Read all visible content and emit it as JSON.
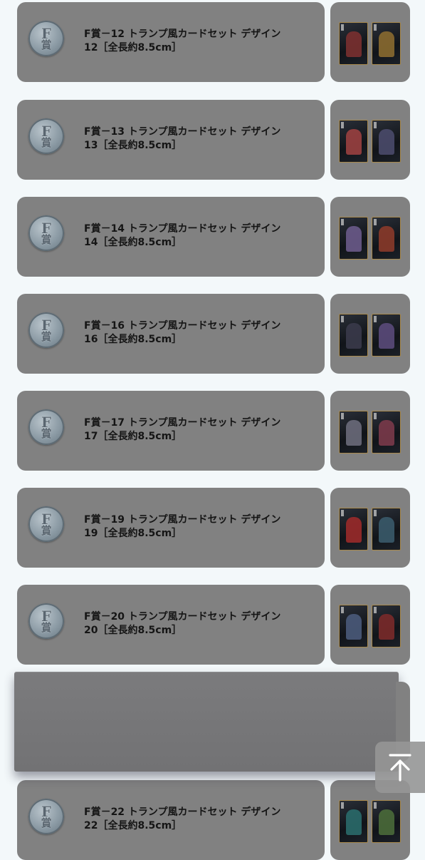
{
  "items": [
    {
      "code": "F賞－12",
      "title": "トランプ風カードセット デザイン",
      "detail": "12［全長約8.5cm］",
      "badge_letter": "F",
      "badge_kanji": "賞",
      "art_left": "#7a3030",
      "art_right": "#8a6a30"
    },
    {
      "code": "F賞－13",
      "title": "トランプ風カードセット デザイン",
      "detail": "13［全長約8.5cm］",
      "badge_letter": "F",
      "badge_kanji": "賞",
      "art_left": "#9a4040",
      "art_right": "#4a4a6a"
    },
    {
      "code": "F賞－14",
      "title": "トランプ風カードセット デザイン",
      "detail": "14［全長約8.5cm］",
      "badge_letter": "F",
      "badge_kanji": "賞",
      "art_left": "#6a5a8a",
      "art_right": "#8a3a2a"
    },
    {
      "code": "F賞－16",
      "title": "トランプ風カードセット デザイン",
      "detail": "16［全長約8.5cm］",
      "badge_letter": "F",
      "badge_kanji": "賞",
      "art_left": "#3a3a4a",
      "art_right": "#5a4a7a"
    },
    {
      "code": "F賞－17",
      "title": "トランプ風カードセット デザイン",
      "detail": "17［全長約8.5cm］",
      "badge_letter": "F",
      "badge_kanji": "賞",
      "art_left": "#6a6a7a",
      "art_right": "#7a3a4a"
    },
    {
      "code": "F賞－19",
      "title": "トランプ風カードセット デザイン",
      "detail": "19［全長約8.5cm］",
      "badge_letter": "F",
      "badge_kanji": "賞",
      "art_left": "#9a2a2a",
      "art_right": "#3a5a6a"
    },
    {
      "code": "F賞－20",
      "title": "トランプ風カードセット デザイン",
      "detail": "20［全長約8.5cm］",
      "badge_letter": "F",
      "badge_kanji": "賞",
      "art_left": "#4a5a7a",
      "art_right": "#7a2a2a"
    },
    {
      "code": "F賞－22",
      "title": "トランプ風カードセット デザイン",
      "detail": "22［全長約8.5cm］",
      "badge_letter": "F",
      "badge_kanji": "賞",
      "art_left": "#2a6a6a",
      "art_right": "#4a6a3a"
    }
  ],
  "scroll_top": {
    "icon": "arrow-up-to-top-icon"
  }
}
